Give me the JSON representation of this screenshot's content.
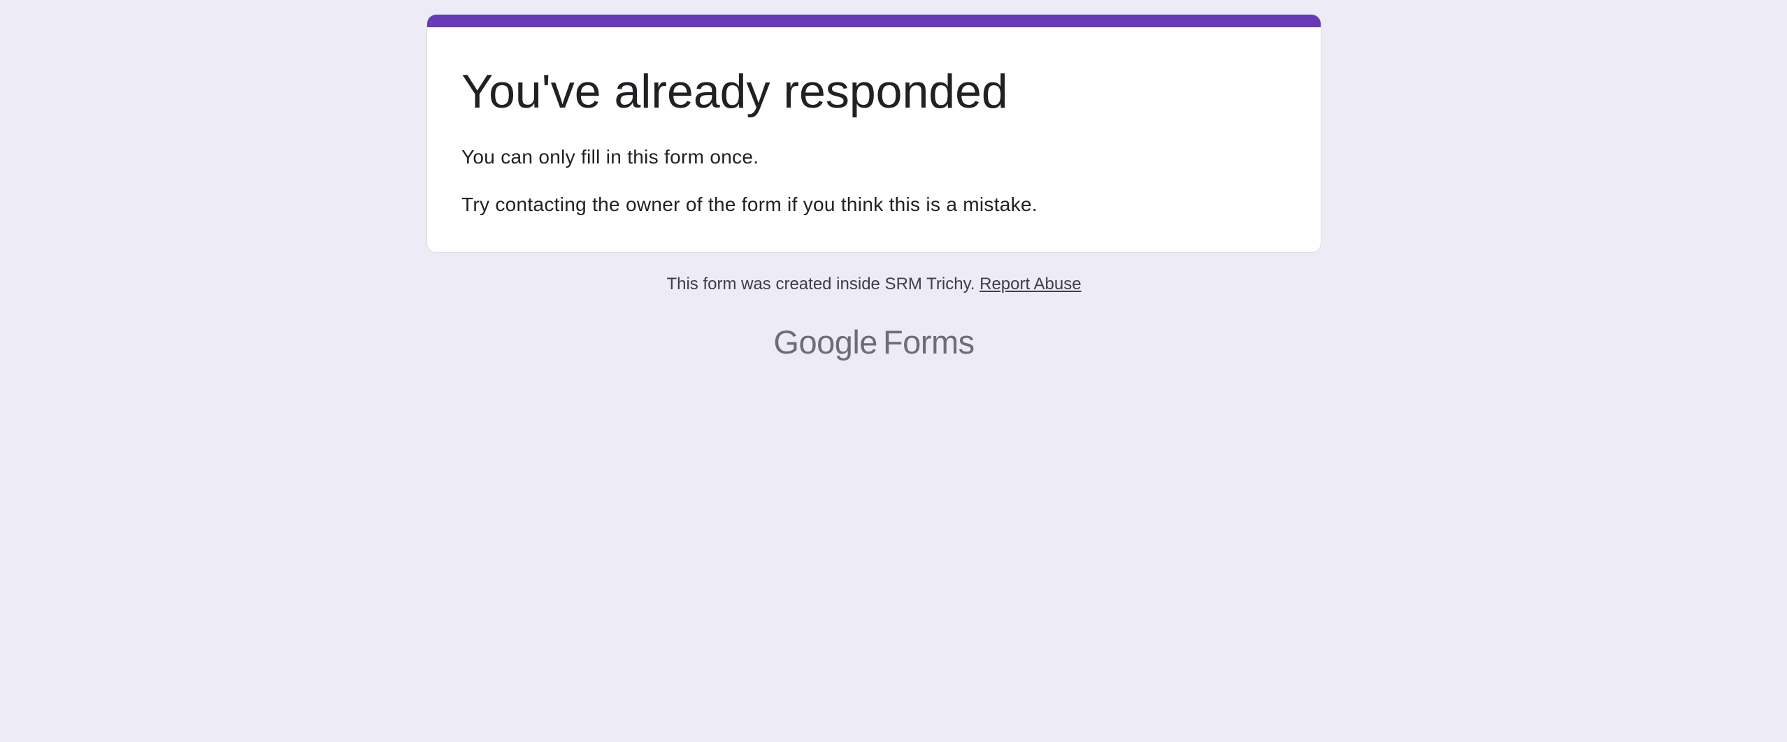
{
  "card": {
    "title": "You've already responded",
    "line1": "You can only fill in this form once.",
    "line2": "Try contacting the owner of the form if you think this is a mistake."
  },
  "footer": {
    "note": "This form was created inside SRM Trichy.",
    "report_link": "Report Abuse"
  },
  "brand": {
    "google": "Google",
    "product": "Forms"
  },
  "colors": {
    "accent": "#673AB7",
    "background": "#EDEBF6",
    "card": "#FFFFFF",
    "brand_text": "#6F6C75"
  }
}
